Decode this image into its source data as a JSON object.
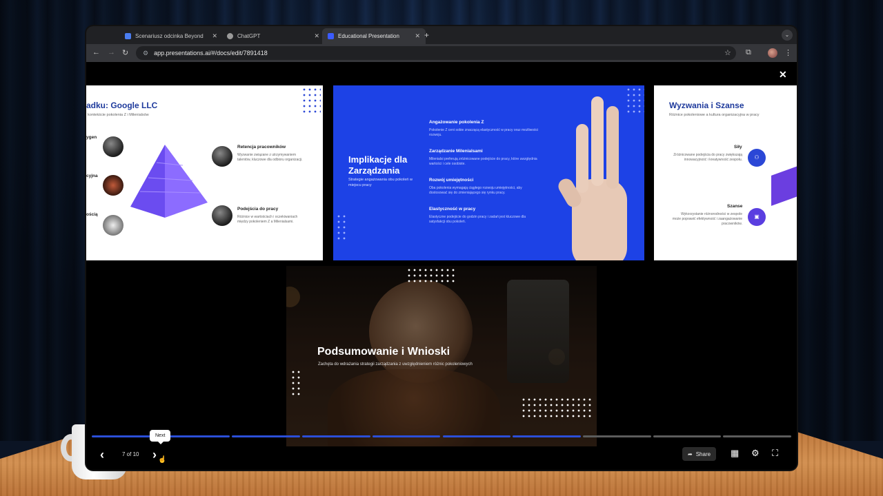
{
  "browser": {
    "tabs": [
      {
        "label": "Scenariusz odcinka Beyond",
        "favicon_color": "#4a7df0",
        "active": false
      },
      {
        "label": "ChatGPT",
        "favicon_color": "#9a9a9a",
        "active": false
      },
      {
        "label": "Educational Presentation",
        "favicon_color": "#3b5bff",
        "active": true
      }
    ],
    "url": "app.presentations.ai/#/docs/edit/7891418"
  },
  "slides": {
    "left": {
      "title": "adku: Google LLC",
      "subtitle": "kontekście pokolenia Z i Milenialsów",
      "fragments": [
        "ygen",
        "cyjna",
        "ością"
      ],
      "items": [
        {
          "title": "Retencja pracowników",
          "desc": "Wyzwanie związane z utrzymywaniem talentów, kluczowe dla odbioru organizacji."
        },
        {
          "title": "Podejścia do pracy",
          "desc": "Różnice w wartościach i oczekiwaniach między pokoleniem Z a Milenialsami."
        }
      ]
    },
    "center": {
      "title": "Implikacje dla Zarządzania",
      "subtitle": "Strategie angażowania obu pokoleń w miejscu pracy",
      "items": [
        {
          "title": "Angażowanie pokolenia Z",
          "desc": "Pokolenie Z ceni sobie znaczącą elastyczność w pracy oraz możliwości rozwoju."
        },
        {
          "title": "Zarządzanie Milenialsami",
          "desc": "Milenialsi preferują zróżnicowane podejście do pracy, które uwzględnia wartości i cele osobiste."
        },
        {
          "title": "Rozwój umiejętności",
          "desc": "Oba pokolenia wymagają ciągłego rozwoju umiejętności, aby dostosować się do zmieniającego się rynku pracy."
        },
        {
          "title": "Elastyczność w pracy",
          "desc": "Elastyczne podejście do godzin pracy i zadań jest kluczowe dla satysfakcji obu pokoleń."
        }
      ]
    },
    "right": {
      "title": "Wyzwania i Szanse",
      "subtitle": "Różnice pokoleniowe a kultura organizacyjna w pracy",
      "items": [
        {
          "title": "Siły",
          "desc": "Zróżnicowane podejścia do pracy zwiększają innowacyjność i kreatywność zespołu."
        },
        {
          "title": "Szanse",
          "desc": "Wykorzystanie różnorodności w zespole może poprawić efektywność i zaangażowanie pracowników."
        }
      ]
    },
    "main": {
      "title": "Podsumowanie i Wnioski",
      "subtitle": "Zachęta do wdrażania strategii zarządzania z uwzględnieniem różnic pokoleniowych"
    }
  },
  "controls": {
    "page_indicator": "7 of 10",
    "current": 7,
    "total": 10,
    "tooltip": "Next",
    "share_label": "Share"
  },
  "colors": {
    "accent": "#1d42e6",
    "progress_active": "#2b4fd8",
    "progress_inactive": "#5c5c5c"
  }
}
